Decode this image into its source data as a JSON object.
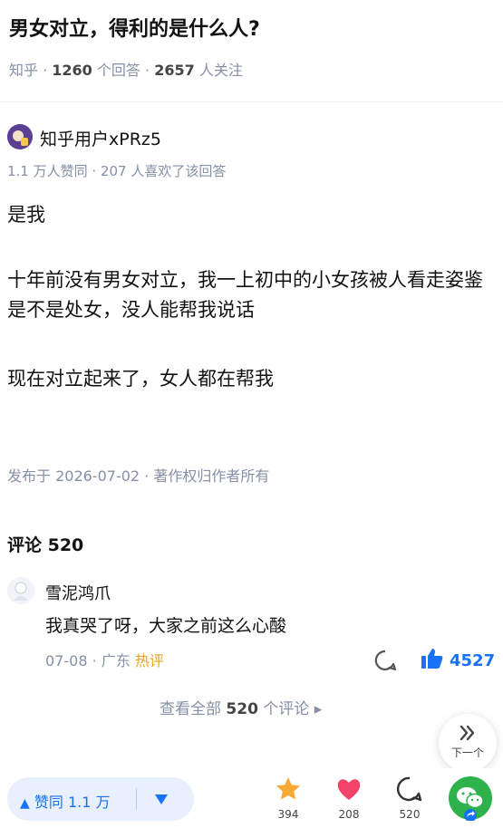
{
  "question": {
    "title": "男女对立，得利的是什么人?",
    "source": "知乎",
    "answers_count": "1260",
    "answers_label": "个回答",
    "followers_count": "2657",
    "followers_label": "人关注"
  },
  "answer": {
    "author": "知乎用户xPRz5",
    "votes_text": "1.1 万人赞同 · 207 人喜欢了该回答",
    "paragraphs": [
      "是我",
      "十年前没有男女对立，我一上初中的小女孩被人看走姿鉴是不是处女，没人能帮我说话",
      "现在对立起来了，女人都在帮我"
    ],
    "published": "发布于 2026-07-02 · 著作权归作者所有"
  },
  "comments": {
    "title": "评论 520",
    "item": {
      "author": "雪泥鸿爪",
      "text": "我真哭了呀，大家之前这么心酸",
      "date": "07-08",
      "location": "广东",
      "tag": "热评",
      "likes": "4527"
    },
    "view_all_prefix": "查看全部",
    "view_all_count": "520",
    "view_all_suffix": "个评论 ▸"
  },
  "next_button": {
    "label": "下一个"
  },
  "bottom": {
    "agree_label": "赞同 1.1 万",
    "favorites": "394",
    "likes": "208",
    "comments": "520"
  },
  "colors": {
    "accent": "#1772f6",
    "muted": "#8590a6",
    "star": "#f7a933",
    "heart": "#f24468",
    "wechat": "#2fb24c",
    "hot": "#f0a020"
  }
}
